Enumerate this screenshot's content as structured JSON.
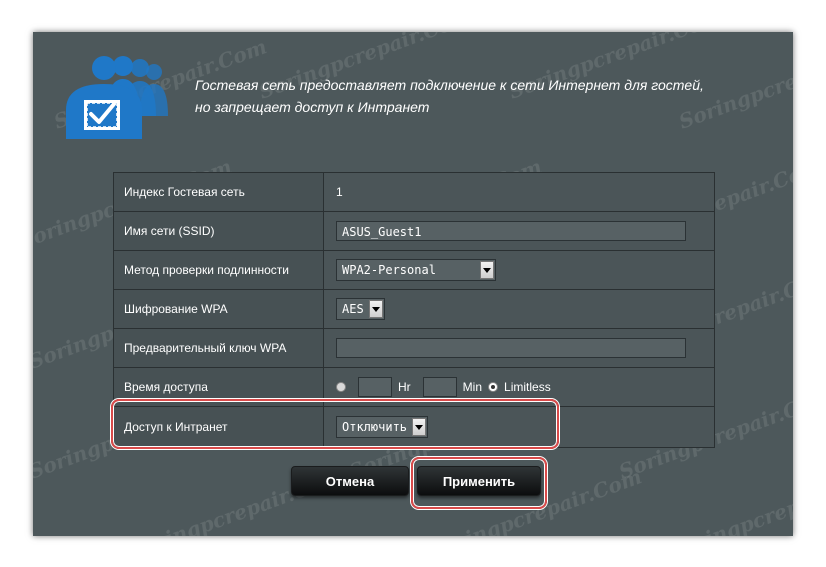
{
  "header": {
    "intro_line1": "Гостевая сеть предоставляет подключение к сети Интернет для гостей,",
    "intro_line2": "но запрещает доступ к Интранет",
    "icon": "guest-users-icon"
  },
  "form": {
    "index": {
      "label": "Индекс Гостевая сеть",
      "value": "1"
    },
    "ssid": {
      "label": "Имя сети (SSID)",
      "value": "ASUS_Guest1"
    },
    "auth_method": {
      "label": "Метод проверки подлинности",
      "value": "WPA2-Personal"
    },
    "wpa_encryption": {
      "label": "Шифрование WPA",
      "value": "AES"
    },
    "wpa_key": {
      "label": "Предварительный ключ WPA",
      "value": ""
    },
    "access_time": {
      "label": "Время доступа",
      "hr_label": "Hr",
      "min_label": "Min",
      "limitless_label": "Limitless",
      "selected": "Limitless"
    },
    "intranet_access": {
      "label": "Доступ к Интранет",
      "value": "Отключить"
    }
  },
  "buttons": {
    "cancel": "Отмена",
    "apply": "Применить"
  },
  "watermark": "Soringpcrepair.Com",
  "colors": {
    "panel_bg": "#4d585b",
    "highlight": "#d94a4a",
    "icon_blue": "#1f78c8"
  }
}
